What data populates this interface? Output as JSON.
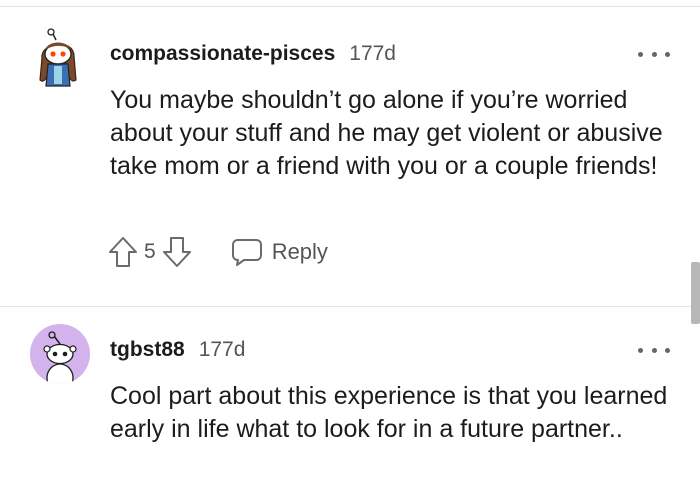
{
  "comments": [
    {
      "username": "compassionate-pisces",
      "time": "177d",
      "body": "You maybe shouldn’t go alone if you’re worried about your stuff and he may get violent or abusive take mom or a friend with you or a couple friends!",
      "votes": "5",
      "reply_label": "Reply",
      "avatar_icon": "snoo-avatar-brown-hair-icon"
    },
    {
      "username": "tgbst88",
      "time": "177d",
      "body": "Cool part about this experience is that you learned early in life what to look for in a future partner..",
      "avatar_icon": "snoo-avatar-purple-icon"
    }
  ],
  "colors": {
    "text": "#1c1c1c",
    "meta": "#555555",
    "divider": "#e4e4e4",
    "avatar_purple_bg": "#d4b3ec"
  }
}
